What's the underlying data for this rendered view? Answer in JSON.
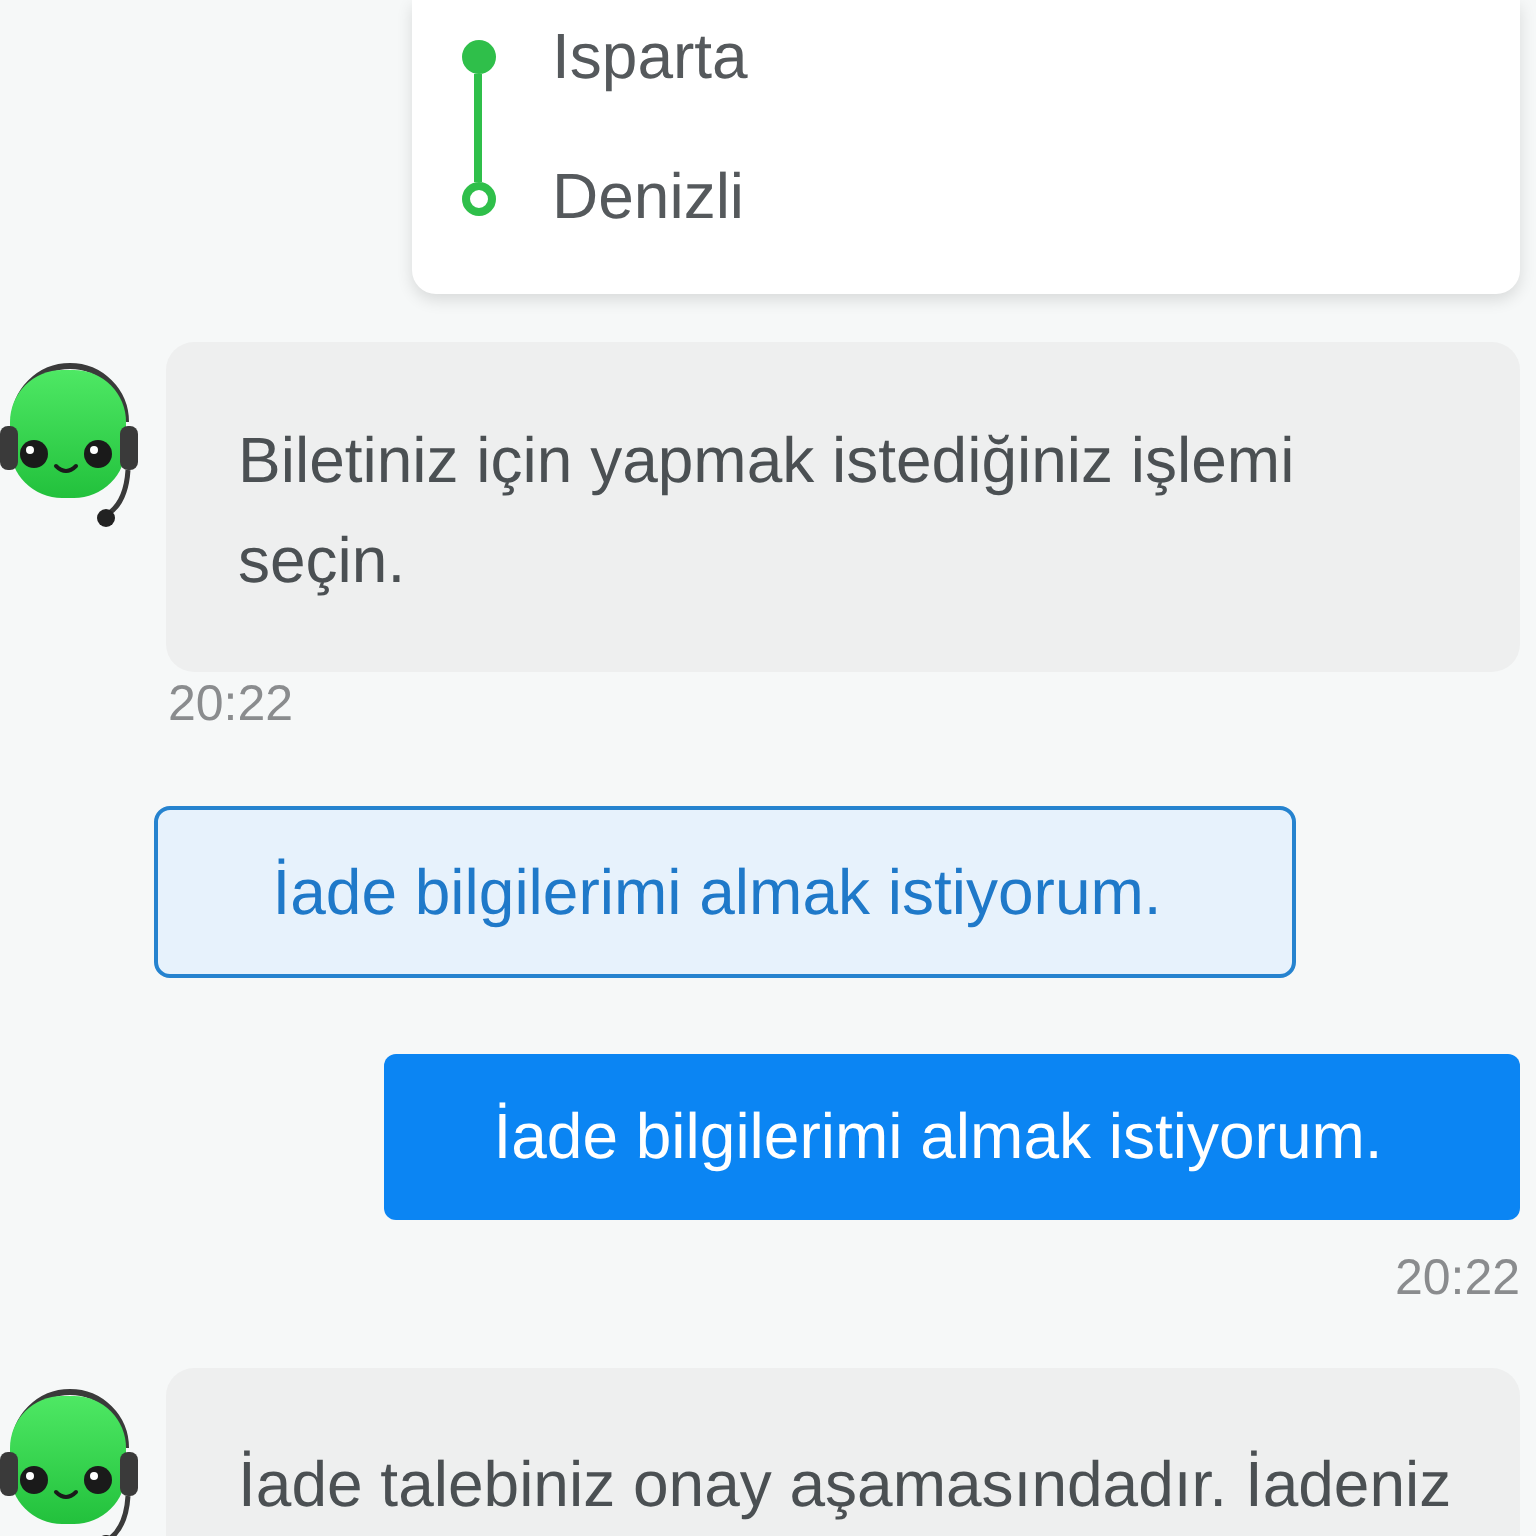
{
  "route_card": {
    "stops": [
      {
        "kind": "origin",
        "name": "Isparta"
      },
      {
        "kind": "destination",
        "name": "Denizli"
      }
    ]
  },
  "messages": [
    {
      "kind": "bot",
      "text": "Biletiniz için yapmak istediğiniz işlemi seçin.",
      "time": "20:22"
    },
    {
      "kind": "option",
      "text": "İade bilgilerimi almak istiyorum."
    },
    {
      "kind": "user",
      "text": "İade bilgilerimi almak istiyorum.",
      "time": "20:22"
    },
    {
      "kind": "bot",
      "text": "İade talebiniz onay aşamasındadır. İadeniz"
    }
  ]
}
